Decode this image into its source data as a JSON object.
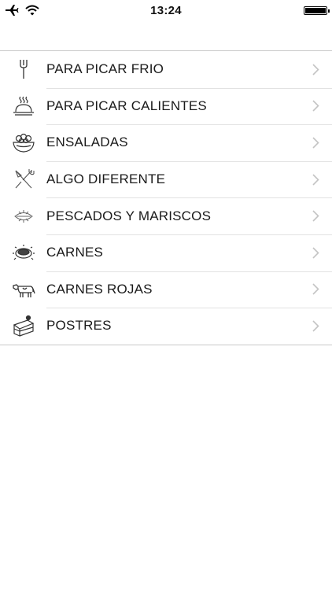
{
  "status_bar": {
    "time": "13:24"
  },
  "menu": {
    "items": [
      {
        "label": "PARA PICAR FRIO",
        "icon": "fork-icon"
      },
      {
        "label": "PARA PICAR CALIENTES",
        "icon": "cloche-icon"
      },
      {
        "label": "ENSALADAS",
        "icon": "salad-bowl-icon"
      },
      {
        "label": "ALGO DIFERENTE",
        "icon": "crossed-utensils-icon"
      },
      {
        "label": "PESCADOS Y MARISCOS",
        "icon": "fish-icon"
      },
      {
        "label": "CARNES",
        "icon": "meat-plate-icon"
      },
      {
        "label": "CARNES ROJAS",
        "icon": "cow-icon"
      },
      {
        "label": "POSTRES",
        "icon": "cake-slice-icon"
      }
    ]
  }
}
